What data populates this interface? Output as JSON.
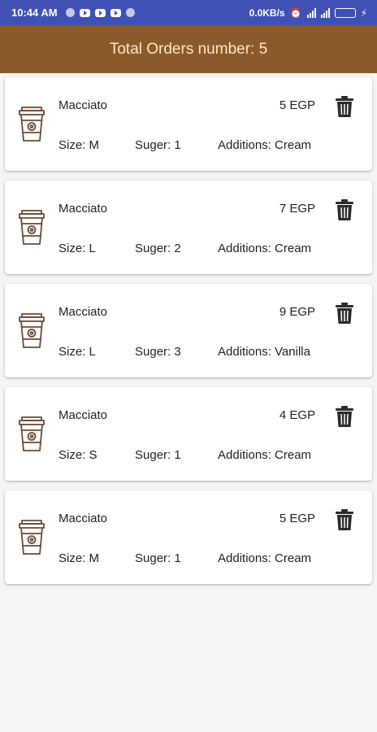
{
  "status_bar": {
    "time": "10:44 AM",
    "net_speed": "0.0KB/s"
  },
  "header": {
    "title": "Total Orders number: 5"
  },
  "orders": [
    {
      "name": "Macciato",
      "price": "5 EGP",
      "size": "Size: M",
      "sugar": "Suger: 1",
      "additions": "Additions: Cream"
    },
    {
      "name": "Macciato",
      "price": "7 EGP",
      "size": "Size: L",
      "sugar": "Suger: 2",
      "additions": "Additions: Cream"
    },
    {
      "name": "Macciato",
      "price": "9 EGP",
      "size": "Size: L",
      "sugar": "Suger: 3",
      "additions": "Additions: Vanilla"
    },
    {
      "name": "Macciato",
      "price": "4 EGP",
      "size": "Size: S",
      "sugar": "Suger: 1",
      "additions": "Additions: Cream"
    },
    {
      "name": "Macciato",
      "price": "5 EGP",
      "size": "Size: M",
      "sugar": "Suger: 1",
      "additions": "Additions: Cream"
    }
  ],
  "icons": {
    "order": "coffee-cup-icon",
    "delete": "trash-icon"
  },
  "colors": {
    "status_bar": "#3f51b5",
    "app_bar": "#8b5a2b",
    "title_text": "#fde9c8",
    "cup_stroke": "#6b4a35",
    "background": "#f5f5f5"
  }
}
